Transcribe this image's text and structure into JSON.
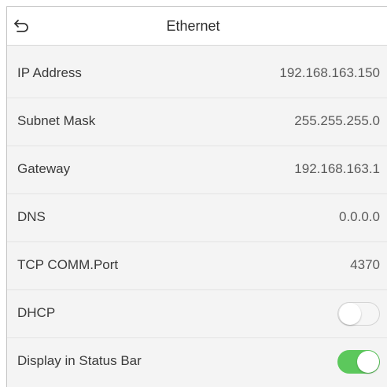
{
  "header": {
    "title": "Ethernet",
    "back_icon": "back-arrow-icon"
  },
  "rows": [
    {
      "label": "IP Address",
      "value": "192.168.163.150"
    },
    {
      "label": "Subnet Mask",
      "value": "255.255.255.0"
    },
    {
      "label": "Gateway",
      "value": "192.168.163.1"
    },
    {
      "label": "DNS",
      "value": "0.0.0.0"
    },
    {
      "label": "TCP COMM.Port",
      "value": "4370"
    },
    {
      "label": "DHCP",
      "toggle": "off"
    },
    {
      "label": "Display in Status Bar",
      "toggle": "on"
    }
  ],
  "colors": {
    "toggle_on": "#5cc85c",
    "toggle_off": "#f6f6f6",
    "background": "#f4f4f4"
  }
}
